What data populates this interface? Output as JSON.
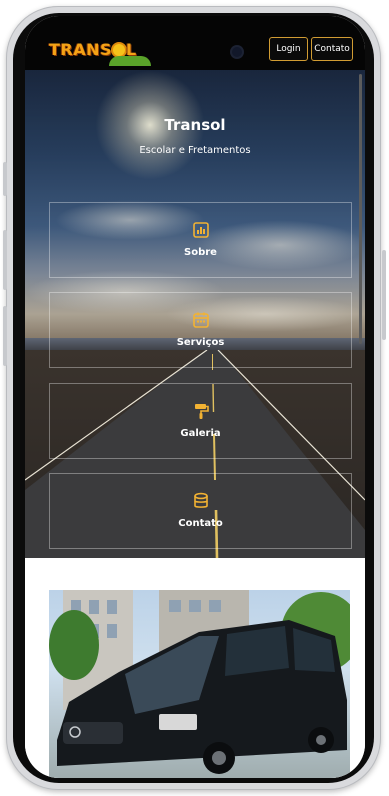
{
  "header": {
    "logo_text_left": "TRANS",
    "logo_text_right": "L",
    "login_label": "Login",
    "contato_label": "Contato"
  },
  "hero": {
    "title": "Transol",
    "subtitle": "Escolar e Fretamentos"
  },
  "cards": [
    {
      "label": "Sobre",
      "icon": "chart-bar-icon"
    },
    {
      "label": "Serviços",
      "icon": "calendar-icon"
    },
    {
      "label": "Galeria",
      "icon": "paint-roller-icon"
    },
    {
      "label": "Contato",
      "icon": "database-icon"
    }
  ],
  "colors": {
    "accent": "#f2b233",
    "header_bg": "#050505",
    "button_border": "#d19c33"
  },
  "photo": {
    "subject": "van-photo"
  }
}
